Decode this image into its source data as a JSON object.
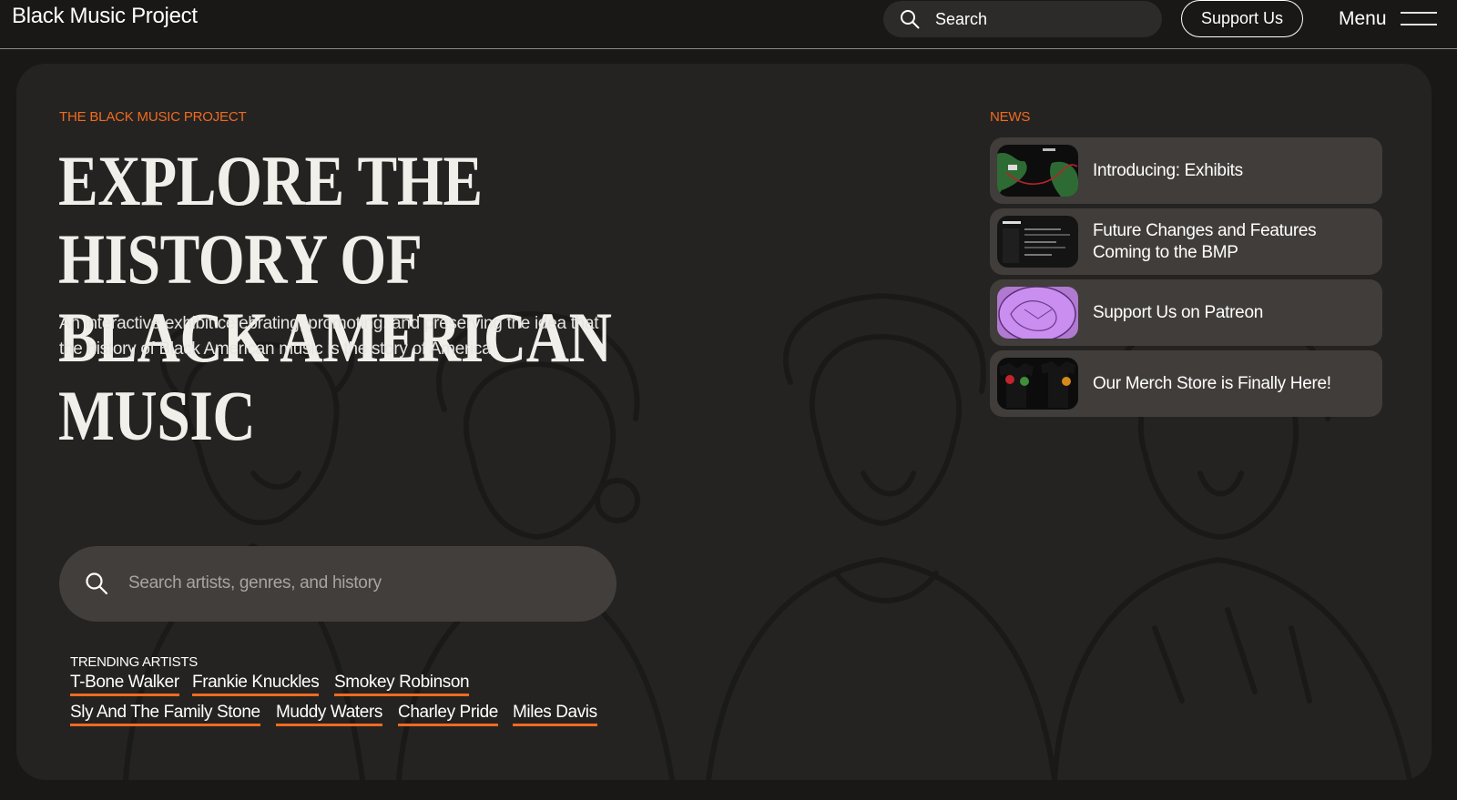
{
  "header": {
    "brand": "Black Music Project",
    "search_label": "Search",
    "support_label": "Support Us",
    "menu_label": "Menu"
  },
  "hero": {
    "eyebrow": "THE BLACK MUSIC PROJECT",
    "title_line1": "EXPLORE THE HISTORY OF",
    "title_line2": "BLACK AMERICAN MUSIC",
    "subtitle_line1": "An interactive exhibit celebrating, promoting, and preserving the idea that",
    "subtitle_line2": "the history of Black American music is the story of America",
    "search_placeholder": "Search artists, genres, and history"
  },
  "trending": {
    "heading": "TRENDING ARTISTS",
    "artists": [
      "T-Bone Walker",
      "Frankie Knuckles",
      "Smokey Robinson",
      "Sly And The Family Stone",
      "Muddy Waters",
      "Charley Pride",
      "Miles Davis"
    ]
  },
  "news": {
    "heading": "NEWS",
    "items": [
      {
        "title_line1": "Introducing: Exhibits",
        "title_line2": ""
      },
      {
        "title_line1": "Future Changes and Features",
        "title_line2": "Coming to the BMP"
      },
      {
        "title_line1": "Support Us on Patreon",
        "title_line2": ""
      },
      {
        "title_line1": "Our Merch Store is Finally Here!",
        "title_line2": ""
      }
    ]
  },
  "colors": {
    "accent": "#f06a1f",
    "panel": "#242322",
    "card": "#413d3a",
    "page": "#191817"
  }
}
